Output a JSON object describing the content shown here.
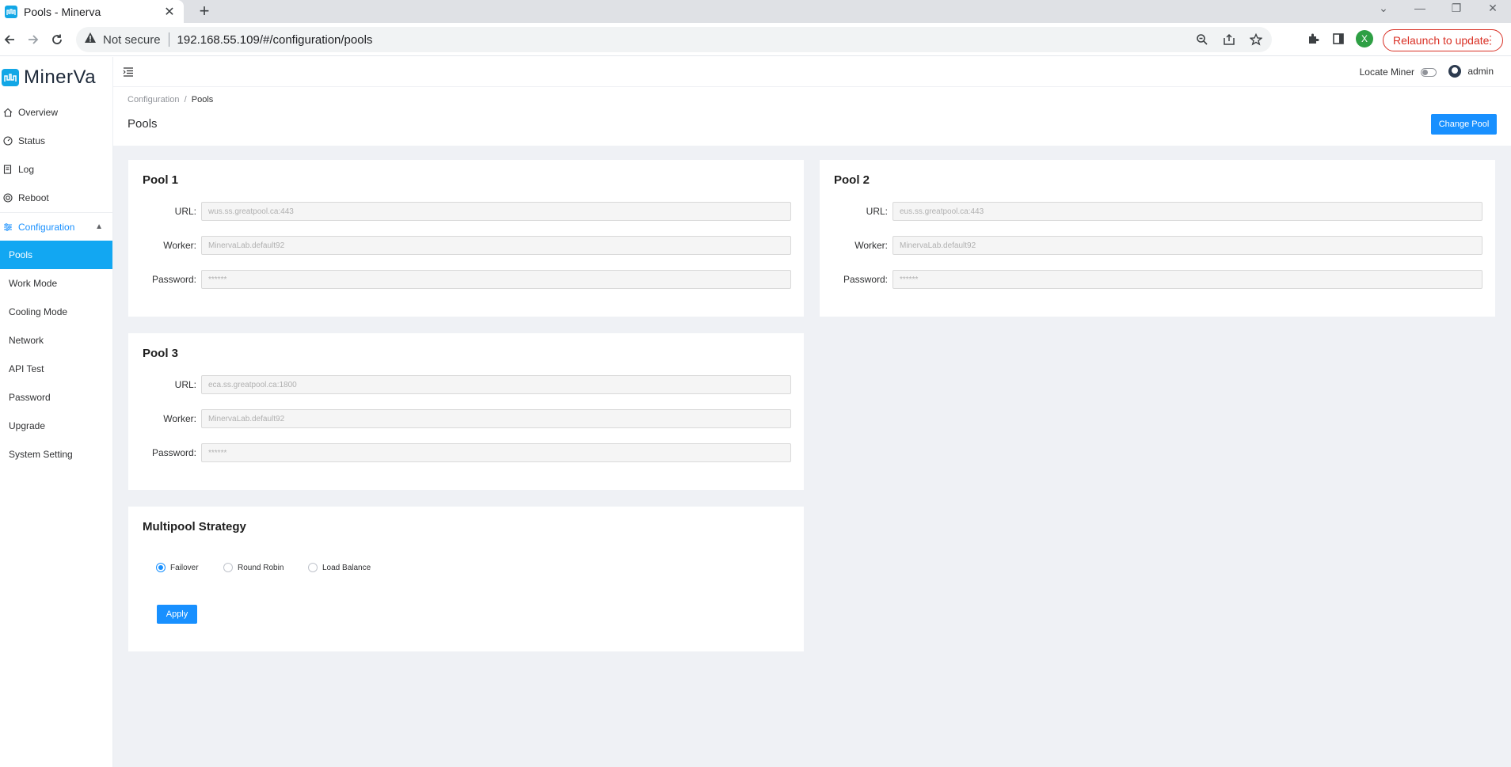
{
  "browser": {
    "tab_title": "Pools - Minerva",
    "not_secure": "Not secure",
    "url": "192.168.55.109/#/configuration/pools",
    "profile_initial": "X",
    "relaunch_label": "Relaunch to update"
  },
  "app": {
    "logo_text": "MinerVa",
    "brand_color": "#12a7e6",
    "accent_color": "#1890ff"
  },
  "sidebar": {
    "items": [
      {
        "label": "Overview",
        "icon": "home-icon"
      },
      {
        "label": "Status",
        "icon": "gauge-icon"
      },
      {
        "label": "Log",
        "icon": "log-icon"
      },
      {
        "label": "Reboot",
        "icon": "reboot-icon"
      }
    ],
    "config_label": "Configuration",
    "submenu": [
      "Pools",
      "Work Mode",
      "Cooling Mode",
      "Network",
      "API Test",
      "Password",
      "Upgrade",
      "System Setting"
    ],
    "active_submenu": "Pools"
  },
  "topbar": {
    "locate_label": "Locate Miner",
    "locate_on": false,
    "user": "admin"
  },
  "page": {
    "breadcrumb_parent": "Configuration",
    "breadcrumb_sep": "/",
    "breadcrumb_current": "Pools",
    "title": "Pools",
    "change_pool_label": "Change Pool"
  },
  "labels": {
    "url": "URL:",
    "worker": "Worker:",
    "password": "Password:"
  },
  "pools": [
    {
      "title": "Pool 1",
      "url": "wus.ss.greatpool.ca:443",
      "worker": "MinervaLab.default92",
      "password": "******"
    },
    {
      "title": "Pool 2",
      "url": "eus.ss.greatpool.ca:443",
      "worker": "MinervaLab.default92",
      "password": "******"
    },
    {
      "title": "Pool 3",
      "url": "eca.ss.greatpool.ca:1800",
      "worker": "MinervaLab.default92",
      "password": "******"
    }
  ],
  "multipool": {
    "title": "Multipool Strategy",
    "options": [
      "Failover",
      "Round Robin",
      "Load Balance"
    ],
    "selected": "Failover",
    "apply_label": "Apply"
  }
}
